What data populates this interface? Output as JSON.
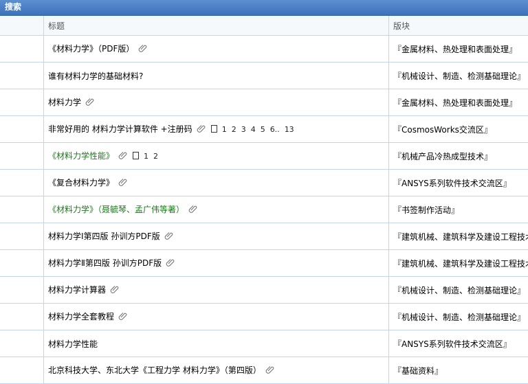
{
  "header": {
    "title": "搜索"
  },
  "columns": {
    "blank": "",
    "title": "标题",
    "forum": "版块"
  },
  "icons": {
    "attachment": "paperclip-icon",
    "pages": "page-icon"
  },
  "colors": {
    "titlebar": "#3d72bb",
    "green_link": "#1b7a1b",
    "grid": "#c3d5ea"
  },
  "rows": [
    {
      "title": "《材料力学》（PDF版）",
      "green": false,
      "attachment": true,
      "pages": [],
      "forum": "『金属材料、热处理和表面处理』"
    },
    {
      "title": "谁有材料力学的基础材料?",
      "green": false,
      "attachment": false,
      "pages": [],
      "forum": "『机械设计、制造、检测基础理论』"
    },
    {
      "title": "材料力学",
      "green": false,
      "attachment": true,
      "pages": [],
      "forum": "『金属材料、热处理和表面处理』"
    },
    {
      "title": "非常好用的 材料力学计算软件 +注册码",
      "green": false,
      "attachment": true,
      "pages": [
        "1",
        "2",
        "3",
        "4",
        "5",
        "6..",
        "13"
      ],
      "forum": "『CosmosWorks交流区』"
    },
    {
      "title": "《材料力学性能》",
      "green": true,
      "attachment": true,
      "pages": [
        "1",
        "2"
      ],
      "forum": "『机械产品冷热成型技术』"
    },
    {
      "title": "《复合材料力学》",
      "green": false,
      "attachment": true,
      "pages": [],
      "forum": "『ANSYS系列软件技术交流区』"
    },
    {
      "title": "《材料力学》（聂毓琴、孟广伟等著）",
      "green": true,
      "attachment": true,
      "pages": [],
      "forum": "『书签制作活动』"
    },
    {
      "title": "材料力学Ⅰ第四版 孙训方PDF版",
      "green": false,
      "attachment": true,
      "pages": [],
      "forum": "『建筑机械、建筑科学及建设工程技术』"
    },
    {
      "title": "材料力学Ⅱ第四版 孙训方PDF版",
      "green": false,
      "attachment": true,
      "pages": [],
      "forum": "『建筑机械、建筑科学及建设工程技术』"
    },
    {
      "title": "材料力学计算器",
      "green": false,
      "attachment": true,
      "pages": [],
      "forum": "『机械设计、制造、检测基础理论』"
    },
    {
      "title": "材料力学全套教程",
      "green": false,
      "attachment": true,
      "pages": [],
      "forum": "『机械设计、制造、检测基础理论』"
    },
    {
      "title": "材料力学性能",
      "green": false,
      "attachment": false,
      "pages": [],
      "forum": "『ANSYS系列软件技术交流区』"
    },
    {
      "title": "北京科技大学、东北大学《工程力学 材料力学》（第四版）",
      "green": false,
      "attachment": true,
      "pages": [],
      "forum": "『基础资料』"
    }
  ]
}
